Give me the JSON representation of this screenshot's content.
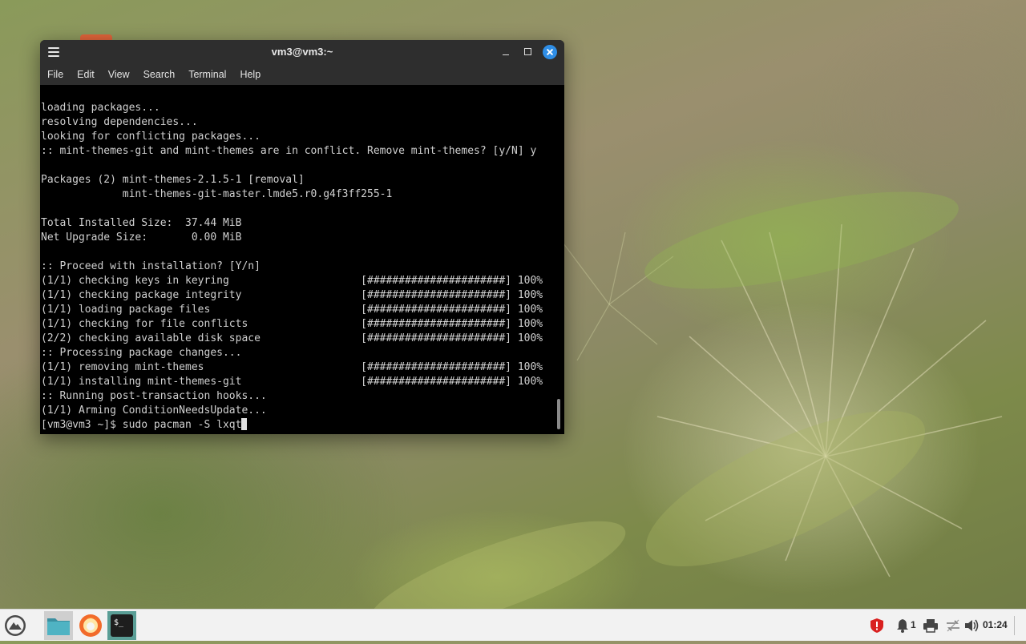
{
  "window": {
    "title": "vm3@vm3:~",
    "menu": [
      "File",
      "Edit",
      "View",
      "Search",
      "Terminal",
      "Help"
    ]
  },
  "terminal": {
    "lines": [
      "loading packages...",
      "resolving dependencies...",
      "looking for conflicting packages...",
      ":: mint-themes-git and mint-themes are in conflict. Remove mint-themes? [y/N] y",
      "",
      "Packages (2) mint-themes-2.1.5-1 [removal]",
      "             mint-themes-git-master.lmde5.r0.g4f3ff255-1",
      "",
      "Total Installed Size:  37.44 MiB",
      "Net Upgrade Size:       0.00 MiB",
      "",
      ":: Proceed with installation? [Y/n]",
      "(1/1) checking keys in keyring                     [######################] 100%",
      "(1/1) checking package integrity                   [######################] 100%",
      "(1/1) loading package files                        [######################] 100%",
      "(1/1) checking for file conflicts                  [######################] 100%",
      "(2/2) checking available disk space                [######################] 100%",
      ":: Processing package changes...",
      "(1/1) removing mint-themes                         [######################] 100%",
      "(1/1) installing mint-themes-git                   [######################] 100%",
      ":: Running post-transaction hooks...",
      "(1/1) Arming ConditionNeedsUpdate..."
    ],
    "prompt": "[vm3@vm3 ~]$ ",
    "command": "sudo pacman -S lxqt"
  },
  "taskbar": {
    "apps": [
      {
        "name": "app-menu",
        "icon": "cinnamon-menu-icon"
      },
      {
        "name": "files",
        "icon": "folder-icon"
      },
      {
        "name": "firefox",
        "icon": "firefox-icon"
      },
      {
        "name": "terminal",
        "icon": "terminal-icon"
      }
    ],
    "tray": {
      "notification_count": "1",
      "clock": "01:24"
    }
  },
  "colors": {
    "accent": "#2f8ee6",
    "terminal_bg": "#000000",
    "terminal_fg": "#d0d0d0",
    "shield": "#d9201f"
  }
}
